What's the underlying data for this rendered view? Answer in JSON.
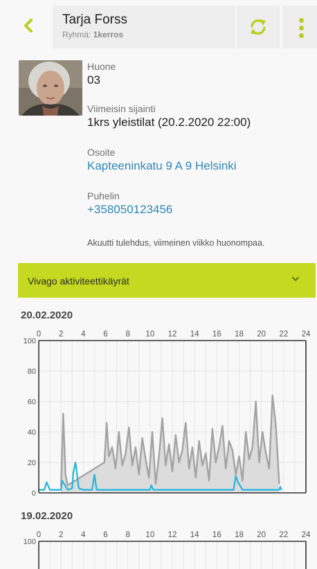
{
  "header": {
    "name": "Tarja Forss",
    "group_label": "Ryhmä:",
    "group_value": "1kerros"
  },
  "profile": {
    "room_label": "Huone",
    "room_value": "03",
    "location_label": "Viimeisin sijainti",
    "location_value": "1krs yleistilat (20.2.2020 22:00)",
    "address_label": "Osoite",
    "address_value": "Kapteeninkatu 9 A 9 Helsinki",
    "phone_label": "Puhelin",
    "phone_value": "+358050123456",
    "note": "Akuutti tulehdus, viimeinen viikko huonompaa."
  },
  "activity": {
    "accordion_title": "Vivago aktiviteettikäyrät"
  },
  "colors": {
    "accent": "#c4d920",
    "icon_accent": "#b8cf1e",
    "link": "#2f87b4",
    "activity_gray": "#a3a3a3",
    "rest_cyan": "#22b5dd"
  },
  "chart_data": [
    {
      "type": "area",
      "title": "20.02.2020",
      "x_ticks": [
        0,
        2,
        4,
        6,
        8,
        10,
        12,
        14,
        16,
        18,
        20,
        22,
        24
      ],
      "y_ticks": [
        0,
        20,
        40,
        60,
        80,
        100
      ],
      "xlim": [
        0,
        24
      ],
      "ylim": [
        0,
        100
      ],
      "grid": true,
      "series": [
        {
          "color": "gray",
          "x": [
            2.0,
            2.2,
            2.4,
            2.6,
            5.9,
            6.1,
            6.3,
            6.6,
            6.9,
            7.2,
            7.5,
            7.8,
            8.1,
            8.4,
            8.7,
            9.0,
            9.3,
            9.6,
            9.9,
            10.2,
            10.5,
            10.8,
            11.1,
            11.4,
            11.7,
            12.0,
            12.3,
            12.6,
            12.9,
            13.2,
            13.5,
            13.8,
            14.1,
            14.4,
            14.7,
            15.0,
            15.3,
            15.6,
            15.9,
            16.2,
            16.5,
            16.8,
            17.1,
            17.4,
            17.7,
            18.0,
            18.3,
            18.6,
            18.9,
            19.2,
            19.5,
            19.8,
            20.1,
            20.4,
            20.7,
            21.0,
            21.3,
            21.6
          ],
          "y": [
            4,
            52,
            12,
            5,
            20,
            46,
            24,
            30,
            16,
            40,
            18,
            26,
            43,
            18,
            30,
            12,
            36,
            22,
            10,
            40,
            6,
            24,
            49,
            18,
            32,
            14,
            38,
            20,
            28,
            46,
            16,
            30,
            10,
            34,
            18,
            26,
            8,
            42,
            20,
            30,
            44,
            16,
            34,
            28,
            12,
            24,
            8,
            40,
            22,
            30,
            60,
            20,
            40,
            26,
            16,
            64,
            44,
            6
          ]
        },
        {
          "color": "cyan",
          "x": [
            0,
            0.5,
            0.7,
            1.0,
            2.0,
            2.1,
            2.6,
            3.0,
            3.1,
            3.3,
            3.6,
            4.0,
            4.8,
            5.0,
            5.2,
            5.9,
            10.0,
            10.1,
            10.3,
            17.5,
            17.7,
            17.9,
            18.3,
            21.6,
            21.7,
            21.8
          ],
          "y": [
            2,
            2,
            7,
            2,
            2,
            8,
            2,
            3,
            13,
            20,
            3,
            2,
            2,
            12,
            2,
            2,
            2,
            5,
            2,
            2,
            11,
            7,
            2,
            2,
            4,
            2
          ]
        }
      ]
    },
    {
      "type": "area",
      "title": "19.02.2020",
      "x_ticks": [
        0,
        2,
        4,
        6,
        8,
        10,
        12,
        14,
        16,
        18,
        20,
        22,
        24
      ],
      "y_ticks": [
        100
      ],
      "xlim": [
        0,
        24
      ],
      "ylim": [
        0,
        100
      ],
      "grid": true,
      "series": []
    }
  ]
}
